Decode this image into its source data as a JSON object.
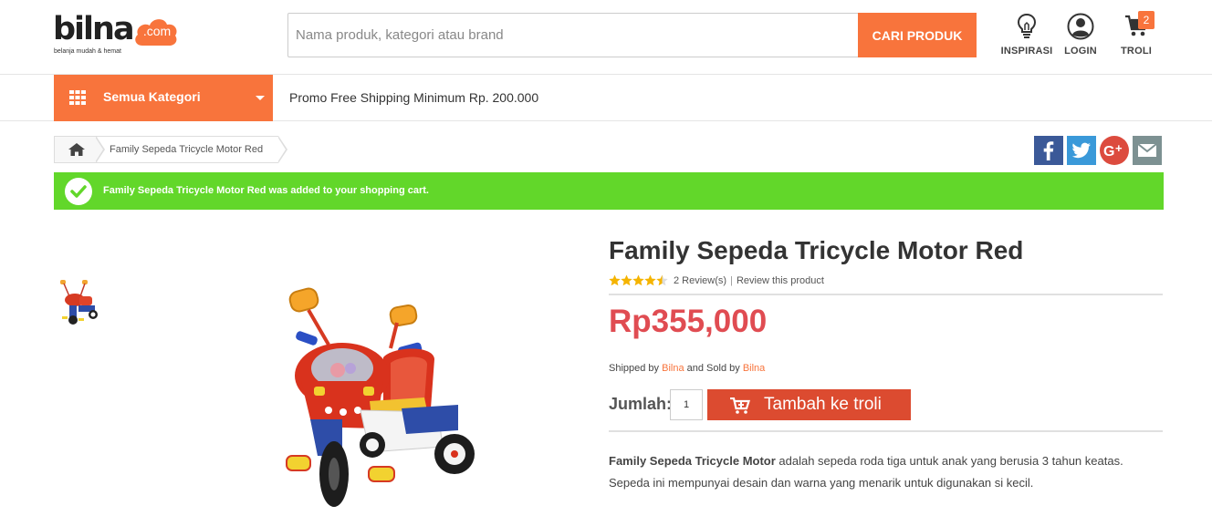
{
  "header": {
    "logo": {
      "word": "bilna",
      "suffix": ".com",
      "tagline": "belanja mudah & hemat"
    },
    "search": {
      "placeholder": "Nama produk, kategori atau brand",
      "value": "",
      "button_label": "CARI PRODUK"
    },
    "icons": [
      {
        "label": "INSPIRASI",
        "icon": "lightbulb-icon"
      },
      {
        "label": "LOGIN",
        "icon": "user-icon"
      },
      {
        "label": "TROLI",
        "icon": "cart-icon",
        "badge": "2"
      }
    ]
  },
  "nav": {
    "category_label": "Semua Kategori",
    "promo": "Promo Free Shipping Minimum Rp. 200.000"
  },
  "breadcrumb": {
    "current": "Family Sepeda Tricycle Motor Red"
  },
  "social": [
    "facebook-icon",
    "twitter-icon",
    "google-plus-icon",
    "email-icon"
  ],
  "alert": {
    "message": "Family Sepeda Tricycle Motor Red was added to your shopping cart."
  },
  "product": {
    "title": "Family Sepeda Tricycle Motor Red",
    "rating": 4.5,
    "rating_max": 5,
    "reviews_count": "2 Review(s)",
    "review_link": "Review this product",
    "price": "Rp355,000",
    "shipped_by_label": "Shipped by",
    "shipped_by": "Bilna",
    "sold_by_label": "and Sold by",
    "sold_by": "Bilna",
    "qty_label": "Jumlah:",
    "qty_value": "1",
    "add_to_cart_label": "Tambah ke troli",
    "description_bold": "Family Sepeda Tricycle Motor",
    "description_rest": " adalah sepeda roda tiga untuk anak yang berusia 3 tahun keatas. Sepeda ini mempunyai desain dan warna yang menarik untuk digunakan si kecil."
  },
  "colors": {
    "accent": "#f8743c",
    "success": "#62d72a",
    "price": "#e04c52",
    "cart_button": "#dc4b30"
  }
}
